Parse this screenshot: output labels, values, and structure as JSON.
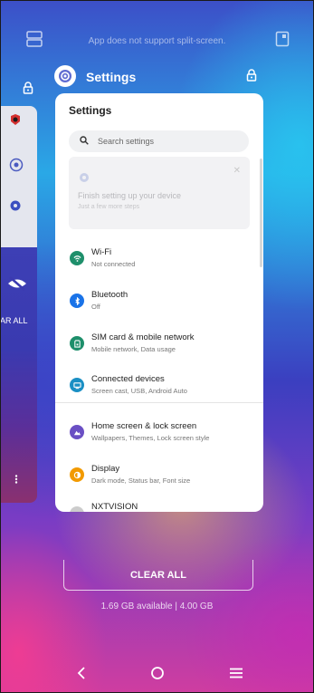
{
  "top": {
    "split_message": "App does not support split-screen."
  },
  "left_card": {
    "clear_fragment": "AR ALL"
  },
  "header": {
    "app_title": "Settings"
  },
  "settings": {
    "title": "Settings",
    "search_placeholder": "Search settings",
    "promo": {
      "title": "Finish setting up your device",
      "subtitle": "Just a few more steps"
    },
    "items": [
      {
        "title": "Wi-Fi",
        "subtitle": "Not connected",
        "color": "#1e8f6b",
        "icon": "wifi-icon"
      },
      {
        "title": "Bluetooth",
        "subtitle": "Off",
        "color": "#1a73e8",
        "icon": "bluetooth-icon"
      },
      {
        "title": "SIM card & mobile network",
        "subtitle": "Mobile network, Data usage",
        "color": "#1e8f6b",
        "icon": "sim-icon"
      },
      {
        "title": "Connected devices",
        "subtitle": "Screen cast, USB, Android Auto",
        "color": "#1a8fc4",
        "icon": "devices-icon"
      },
      {
        "title": "Home screen & lock screen",
        "subtitle": "Wallpapers, Themes, Lock screen style",
        "color": "#6a4fc4",
        "icon": "home-screen-icon"
      },
      {
        "title": "Display",
        "subtitle": "Dark mode, Status bar, Font size",
        "color": "#f29a00",
        "icon": "display-icon"
      },
      {
        "title": "NXTVISION",
        "subtitle": "",
        "color": "#cccccc",
        "icon": "nxtvision-icon"
      }
    ]
  },
  "recents": {
    "clear_all": "CLEAR ALL",
    "memory": "1.69 GB available | 4.00 GB"
  }
}
